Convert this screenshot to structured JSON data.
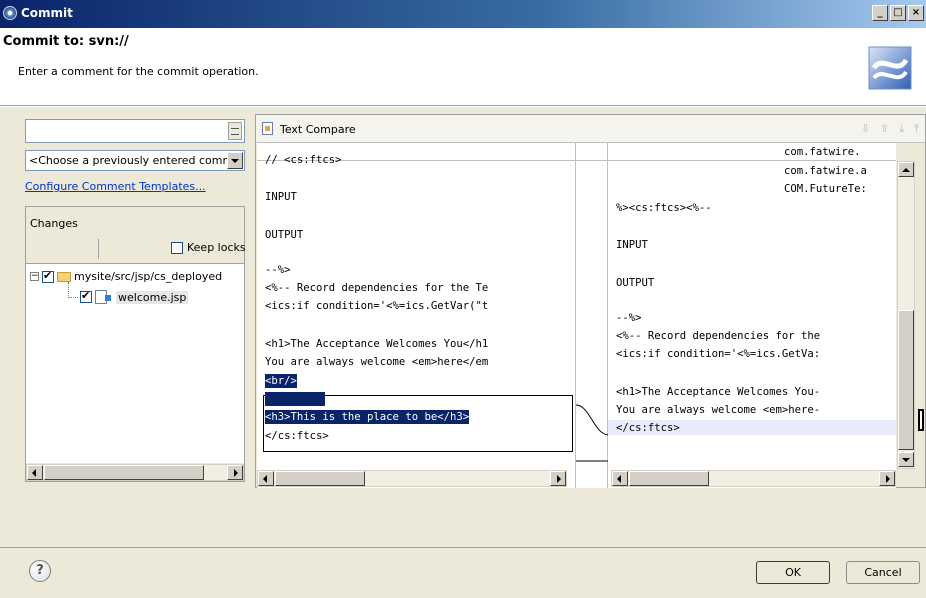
{
  "window": {
    "title": "Commit"
  },
  "header": {
    "title": "Commit to: svn://",
    "message": "Enter a comment for the commit operation."
  },
  "comment": {
    "value": "",
    "previous_placeholder": "<Choose a previously entered comm",
    "templates_link": "Configure Comment Templates..."
  },
  "changes": {
    "title": "Changes",
    "keep_locks_label": "Keep locks",
    "keep_locks_checked": false,
    "tree": [
      {
        "label": "mysite/src/jsp/cs_deployed",
        "checked": true,
        "expanded": true
      },
      {
        "label": "welcome.jsp",
        "checked": true,
        "selected": true
      }
    ]
  },
  "compare": {
    "title": "Text Compare",
    "left_lines": [
      "// <cs:ftcs>",
      "",
      "INPUT",
      "",
      "OUTPUT",
      "",
      "--%>",
      "<%-- Record dependencies for the Te",
      "<ics:if condition='<%=ics.GetVar(\"t",
      "",
      "<h1>The Acceptance Welcomes You</h1",
      "You are always welcome <em>here</em",
      "<br/>",
      "",
      "<h3>This is the place to be</h3>",
      "</cs:ftcs>"
    ],
    "right_lines": [
      "com.fatwire.",
      "com.fatwire.a",
      "COM.FutureTe:",
      "%><cs:ftcs><%--",
      "",
      "INPUT",
      "",
      "OUTPUT",
      "",
      "--%>",
      "<%-- Record dependencies for the",
      "<ics:if condition='<%=ics.GetVa:",
      "",
      "<h1>The Acceptance Welcomes You-",
      "You are always welcome <em>here-",
      "</cs:ftcs>"
    ]
  },
  "buttons": {
    "help": "?",
    "ok": "OK",
    "cancel": "Cancel"
  }
}
